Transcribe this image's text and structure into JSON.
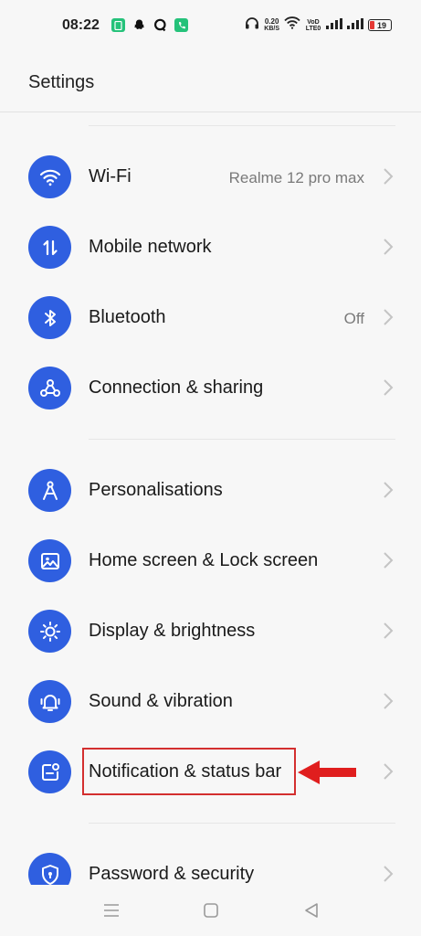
{
  "status_bar": {
    "time": "08:22",
    "net_speed_value": "0.20",
    "net_speed_unit": "KB/S",
    "network_tag": "VoD LTE0",
    "battery_level": "19"
  },
  "header": {
    "title": "Settings"
  },
  "groups": [
    [
      {
        "label": "Wi-Fi",
        "value": "Realme 12 pro max",
        "icon": "wifi-icon"
      },
      {
        "label": "Mobile network",
        "value": "",
        "icon": "mobile-network-icon"
      },
      {
        "label": "Bluetooth",
        "value": "Off",
        "icon": "bluetooth-icon"
      },
      {
        "label": "Connection & sharing",
        "value": "",
        "icon": "connection-sharing-icon"
      }
    ],
    [
      {
        "label": "Personalisations",
        "value": "",
        "icon": "personalisation-icon"
      },
      {
        "label": "Home screen & Lock screen",
        "value": "",
        "icon": "image-icon"
      },
      {
        "label": "Display & brightness",
        "value": "",
        "icon": "brightness-icon"
      },
      {
        "label": "Sound & vibration",
        "value": "",
        "icon": "bell-icon"
      },
      {
        "label": "Notification & status bar",
        "value": "",
        "icon": "notification-icon"
      }
    ],
    [
      {
        "label": "Password & security",
        "value": "",
        "icon": "shield-icon"
      }
    ]
  ],
  "colors": {
    "accent": "#2f5fe0",
    "annotation": "#d32f2f",
    "background": "#f7f7f7"
  }
}
